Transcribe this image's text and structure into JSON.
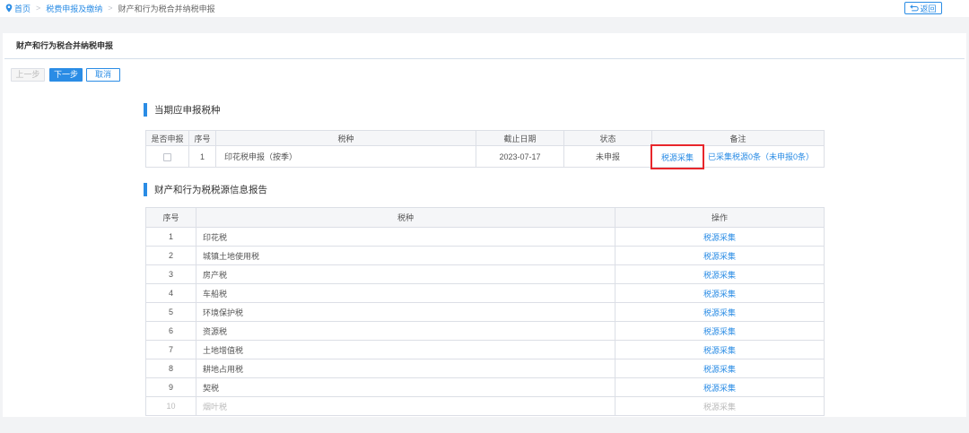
{
  "breadcrumb": {
    "items": [
      "首页",
      "税费申报及缴纳",
      "财产和行为税合并纳税申报"
    ],
    "separator": ">"
  },
  "back_button": {
    "label": "返回"
  },
  "tab": {
    "label": "财产和行为税合并纳税申报"
  },
  "actions": {
    "prev": {
      "label": "上一步",
      "disabled": true
    },
    "next": {
      "label": "下一步",
      "disabled": false
    },
    "cancel": {
      "label": "取消",
      "disabled": false
    }
  },
  "section1": {
    "title": "当期应申报税种",
    "columns": [
      "是否申报",
      "序号",
      "税种",
      "截止日期",
      "状态",
      "备注"
    ],
    "rows": [
      {
        "checked": false,
        "index": "1",
        "tax": "印花税申报（按季）",
        "deadline": "2023-07-17",
        "status": "未申报",
        "collect_link": "税源采集",
        "collect_link_highlighted": true,
        "collected_note": "已采集税源0条（未申报0条）"
      }
    ]
  },
  "section2": {
    "title": "财产和行为税税源信息报告",
    "columns": [
      "序号",
      "税种",
      "操作"
    ],
    "rows": [
      {
        "index": "1",
        "tax": "印花税",
        "action": "税源采集",
        "disabled": false
      },
      {
        "index": "2",
        "tax": "城镇土地使用税",
        "action": "税源采集",
        "disabled": false
      },
      {
        "index": "3",
        "tax": "房产税",
        "action": "税源采集",
        "disabled": false
      },
      {
        "index": "4",
        "tax": "车船税",
        "action": "税源采集",
        "disabled": false
      },
      {
        "index": "5",
        "tax": "环境保护税",
        "action": "税源采集",
        "disabled": false
      },
      {
        "index": "6",
        "tax": "资源税",
        "action": "税源采集",
        "disabled": false
      },
      {
        "index": "7",
        "tax": "土地增值税",
        "action": "税源采集",
        "disabled": false
      },
      {
        "index": "8",
        "tax": "耕地占用税",
        "action": "税源采集",
        "disabled": false
      },
      {
        "index": "9",
        "tax": "契税",
        "action": "税源采集",
        "disabled": false
      },
      {
        "index": "10",
        "tax": "烟叶税",
        "action": "税源采集",
        "disabled": true
      }
    ]
  },
  "icons": {
    "breadcrumb": "location-pin-icon",
    "back": "return-icon",
    "checkbox": "checkbox-icon"
  },
  "colors": {
    "accent": "#2a8ce5",
    "highlight": "#e8262b",
    "disabled_text": "#bbbbbb"
  }
}
